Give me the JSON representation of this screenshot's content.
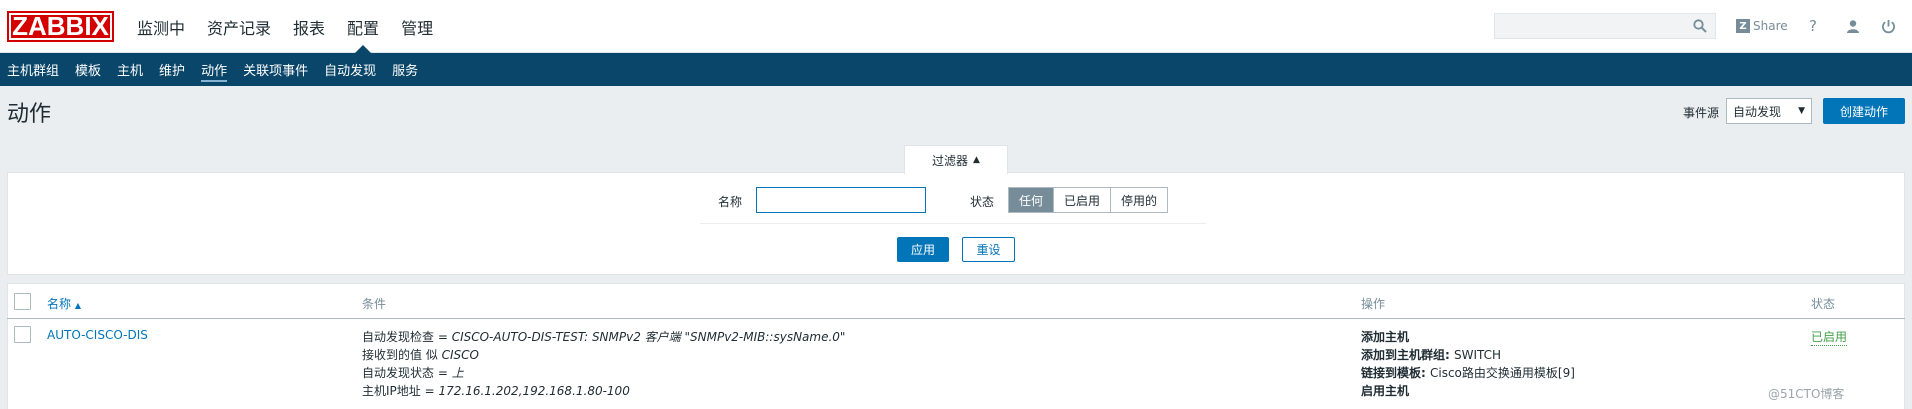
{
  "header": {
    "logo": "ZABBIX",
    "menu": [
      "监测中",
      "资产记录",
      "报表",
      "配置",
      "管理"
    ],
    "active_menu": 3,
    "search_placeholder": "",
    "share_label": "Share",
    "help_icon": "?"
  },
  "subnav": {
    "items": [
      "主机群组",
      "模板",
      "主机",
      "维护",
      "动作",
      "关联项事件",
      "自动发现",
      "服务"
    ],
    "active": 4
  },
  "page": {
    "title": "动作",
    "event_source_label": "事件源",
    "event_source_value": "自动发现",
    "create_button": "创建动作"
  },
  "filter": {
    "tab_label": "过滤器",
    "name_label": "名称",
    "name_value": "",
    "status_label": "状态",
    "status_options": [
      "任何",
      "已启用",
      "停用的"
    ],
    "status_active": 0,
    "apply_button": "应用",
    "reset_button": "重设"
  },
  "table": {
    "columns": {
      "name": "名称",
      "conditions": "条件",
      "operations": "操作",
      "status": "状态"
    },
    "rows": [
      {
        "name": "AUTO-CISCO-DIS",
        "conditions": [
          {
            "label": "自动发现检查 = ",
            "value": "CISCO-AUTO-DIS-TEST: SNMPv2 客户端 \"SNMPv2-MIB::sysName.0\""
          },
          {
            "label": "接收到的值 似 ",
            "value": "CISCO"
          },
          {
            "label": "自动发现状态 = ",
            "value": "上"
          },
          {
            "label": "主机IP地址 = ",
            "value": "172.16.1.202,192.168.1.80-100"
          }
        ],
        "operations": [
          {
            "label": "添加主机",
            "value": ""
          },
          {
            "label": "添加到主机群组: ",
            "value": "SWITCH"
          },
          {
            "label": "链接到模板: ",
            "value": "Cisco路由交换通用模板[9]"
          },
          {
            "label": "启用主机",
            "value": ""
          }
        ],
        "status": "已启用"
      }
    ]
  },
  "watermark": "@51CTO博客",
  "colors": {
    "nav_bg": "#0a466a",
    "primary": "#0275b8",
    "enabled_green": "#429e47",
    "logo_red": "#d40000"
  }
}
